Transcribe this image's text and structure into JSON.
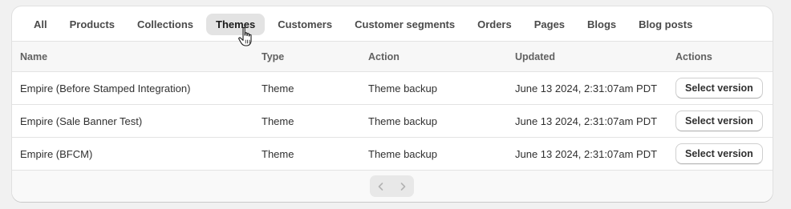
{
  "tabs": [
    {
      "label": "All",
      "active": false
    },
    {
      "label": "Products",
      "active": false
    },
    {
      "label": "Collections",
      "active": false
    },
    {
      "label": "Themes",
      "active": true
    },
    {
      "label": "Customers",
      "active": false
    },
    {
      "label": "Customer segments",
      "active": false
    },
    {
      "label": "Orders",
      "active": false
    },
    {
      "label": "Pages",
      "active": false
    },
    {
      "label": "Blogs",
      "active": false
    },
    {
      "label": "Blog posts",
      "active": false
    }
  ],
  "table": {
    "headers": {
      "name": "Name",
      "type": "Type",
      "action": "Action",
      "updated": "Updated",
      "actions": "Actions"
    },
    "rows": [
      {
        "name": "Empire (Before Stamped Integration)",
        "type": "Theme",
        "action": "Theme backup",
        "updated": "June 13 2024, 2:31:07am PDT",
        "button": "Select version"
      },
      {
        "name": "Empire (Sale Banner Test)",
        "type": "Theme",
        "action": "Theme backup",
        "updated": "June 13 2024, 2:31:07am PDT",
        "button": "Select version"
      },
      {
        "name": "Empire (BFCM)",
        "type": "Theme",
        "action": "Theme backup",
        "updated": "June 13 2024, 2:31:07am PDT",
        "button": "Select version"
      }
    ]
  },
  "pagination": {
    "prev_icon": "chevron-left-icon",
    "next_icon": "chevron-right-icon",
    "prev_enabled": false,
    "next_enabled": false
  },
  "cursor": {
    "icon": "hand-pointer-cursor"
  },
  "colors": {
    "page_background": "#f1f1f1",
    "card_background": "#ffffff",
    "active_tab_background": "#e3e3e3",
    "header_row_background": "#f7f7f7",
    "border": "#e3e3e3"
  }
}
